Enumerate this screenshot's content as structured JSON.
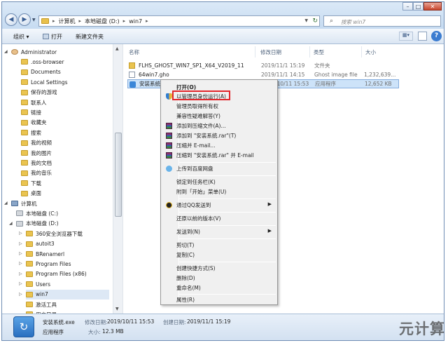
{
  "window": {
    "controls": {
      "minimize": "–",
      "maximize": "□",
      "close": "✕"
    }
  },
  "address": {
    "crumbs": [
      "计算机",
      "本地磁盘 (D:)",
      "win7"
    ],
    "search_placeholder": "搜索 win7"
  },
  "toolbar": {
    "organize": "组织 ▾",
    "open": "打开",
    "new_folder": "新建文件夹"
  },
  "nav_tree": [
    {
      "label": "Administrator",
      "icon": "user-icon"
    },
    {
      "label": ".oss-browser",
      "icon": "folder-icon"
    },
    {
      "label": "Documents",
      "icon": "folder-icon"
    },
    {
      "label": "Local Settings",
      "icon": "folder-icon"
    },
    {
      "label": "保存的游戏",
      "icon": "folder-icon"
    },
    {
      "label": "联系人",
      "icon": "folder-icon"
    },
    {
      "label": "链接",
      "icon": "folder-icon"
    },
    {
      "label": "收藏夹",
      "icon": "folder-icon"
    },
    {
      "label": "搜索",
      "icon": "folder-icon"
    },
    {
      "label": "我的视频",
      "icon": "folder-icon"
    },
    {
      "label": "我的图片",
      "icon": "folder-icon"
    },
    {
      "label": "我的文档",
      "icon": "folder-icon"
    },
    {
      "label": "我的音乐",
      "icon": "folder-icon"
    },
    {
      "label": "下载",
      "icon": "folder-icon"
    },
    {
      "label": "桌面",
      "icon": "folder-icon"
    },
    {
      "label": "计算机",
      "icon": "computer-icon"
    },
    {
      "label": "本地磁盘 (C:)",
      "icon": "drive-icon"
    },
    {
      "label": "本地磁盘 (D:)",
      "icon": "drive-icon"
    },
    {
      "label": "360安全浏览器下载",
      "icon": "folder-icon"
    },
    {
      "label": "autoit3",
      "icon": "folder-icon"
    },
    {
      "label": "BRenamerl",
      "icon": "folder-icon"
    },
    {
      "label": "Program Files",
      "icon": "folder-icon"
    },
    {
      "label": "Program Files (x86)",
      "icon": "folder-icon"
    },
    {
      "label": "Users",
      "icon": "folder-icon"
    },
    {
      "label": "win7",
      "icon": "folder-icon"
    },
    {
      "label": "激活工具",
      "icon": "folder-icon"
    },
    {
      "label": "用户目录",
      "icon": "folder-icon"
    }
  ],
  "columns": {
    "name": "名称",
    "date": "修改日期",
    "type": "类型",
    "size": "大小"
  },
  "files": [
    {
      "name": "FLHS_GHOST_WIN7_SP1_X64_V2019_11",
      "date": "2019/11/1 15:19",
      "type": "文件夹",
      "size": "",
      "icon": "folder-icon"
    },
    {
      "name": "64win7.gho",
      "date": "2019/11/1 14:15",
      "type": "Ghost image file",
      "size": "1,232,639...",
      "icon": "ghost-file-icon"
    },
    {
      "name": "安装系统.e",
      "date": "2019/10/11 15:53",
      "type": "应用程序",
      "size": "12,652 KB",
      "icon": "installer-icon"
    }
  ],
  "context_menu": {
    "open": "打开(O)",
    "run_as_admin": "以管理员身份运行(A)",
    "take_ownership": "管理员取得所有权",
    "troubleshoot": "兼容性疑难解答(Y)",
    "add_archive": "添加到压缩文件(A)...",
    "add_rar": "添加到 \"安装系统.rar\"(T)",
    "compress_email": "压缩并 E-mail...",
    "compress_rar_email": "压缩到 \"安装系统.rar\" 并 E-mail",
    "upload_baidu": "上传到百度网盘",
    "pin_taskbar": "锁定到任务栏(K)",
    "pin_start": "附到「开始」菜单(U)",
    "send_qq": "通过QQ发送到",
    "restore_prev": "还原以前的版本(V)",
    "send_to": "发送到(N)",
    "cut": "剪切(T)",
    "copy": "复制(C)",
    "create_shortcut": "创建快捷方式(S)",
    "delete": "删除(D)",
    "rename": "重命名(M)",
    "properties": "属性(R)"
  },
  "details": {
    "filename": "安装系统.exe",
    "type": "应用程序",
    "modified_label": "修改日期:",
    "modified": "2019/10/11 15:53",
    "created_label": "创建日期:",
    "created": "2019/11/1 15:19",
    "size_label": "大小:",
    "size": "12.3 MB"
  },
  "watermark": "元计算",
  "colors": {
    "highlight": "#e1252a",
    "selection": "#cde3f9"
  }
}
